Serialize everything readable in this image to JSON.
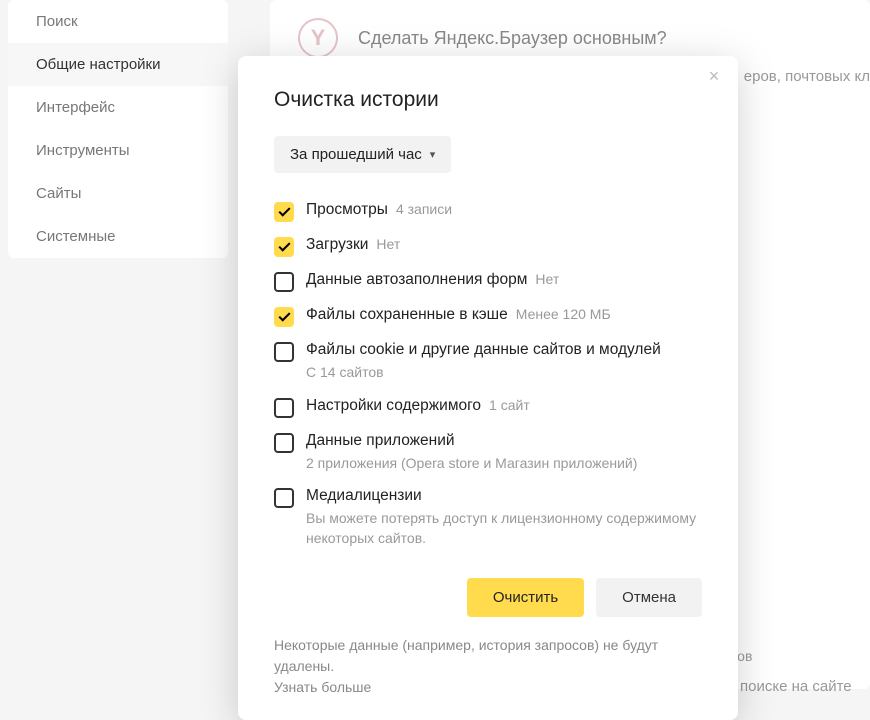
{
  "sidebar": {
    "items": [
      {
        "label": "Поиск",
        "active": false
      },
      {
        "label": "Общие настройки",
        "active": true
      },
      {
        "label": "Интерфейс",
        "active": false
      },
      {
        "label": "Инструменты",
        "active": false
      },
      {
        "label": "Сайты",
        "active": false
      },
      {
        "label": "Системные",
        "active": false
      }
    ]
  },
  "bg": {
    "promo_title": "Сделать Яндекс.Браузер основным?",
    "promo_sub": "еров, почтовых кл",
    "logo_letter": "Y",
    "text1": "сов",
    "text2": "поиске на сайте"
  },
  "modal": {
    "title": "Очистка истории",
    "close_glyph": "×",
    "dropdown": {
      "label": "За прошедший час"
    },
    "items": [
      {
        "checked": true,
        "label": "Просмотры",
        "hint": "4 записи",
        "sub": ""
      },
      {
        "checked": true,
        "label": "Загрузки",
        "hint": "Нет",
        "sub": ""
      },
      {
        "checked": false,
        "label": "Данные автозаполнения форм",
        "hint": "Нет",
        "sub": ""
      },
      {
        "checked": true,
        "label": "Файлы сохраненные в кэше",
        "hint": "Менее 120 МБ",
        "sub": ""
      },
      {
        "checked": false,
        "label": "Файлы cookie и другие данные сайтов и модулей",
        "hint": "",
        "sub": "С 14 сайтов"
      },
      {
        "checked": false,
        "label": "Настройки содержимого",
        "hint": "1 сайт",
        "sub": ""
      },
      {
        "checked": false,
        "label": "Данные приложений",
        "hint": "",
        "sub": "2 приложения (Opera store и Магазин приложений)"
      },
      {
        "checked": false,
        "label": "Медиалицензии",
        "hint": "",
        "sub": "Вы можете потерять доступ к лицензионному содержимому некоторых сайтов."
      }
    ],
    "actions": {
      "primary": "Очистить",
      "secondary": "Отмена"
    },
    "footer_text": "Некоторые данные (например, история запросов) не будут удалены.",
    "footer_link": "Узнать больше"
  }
}
